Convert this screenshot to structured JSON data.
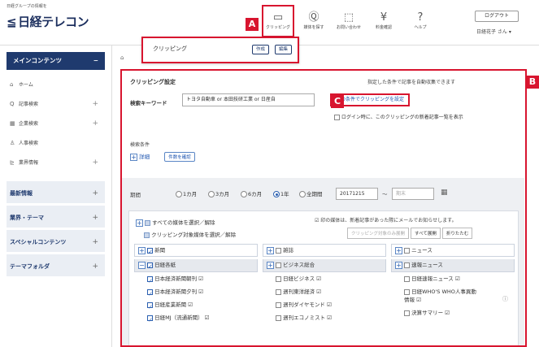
{
  "header": {
    "tagline": "日経グループの情報を",
    "logo": "日経テレコン",
    "logo_mark": "≦",
    "nav": [
      {
        "label": "クリッピング",
        "icon": "folder-icon",
        "glyph": "▭"
      },
      {
        "label": "媒体を探す",
        "icon": "search-icon",
        "glyph": "Ⓠ"
      },
      {
        "label": "お問い合わせ",
        "icon": "chat-icon",
        "glyph": "⬚"
      },
      {
        "label": "料金確認",
        "icon": "yen-icon",
        "glyph": "¥"
      },
      {
        "label": "ヘルプ",
        "icon": "help-icon",
        "glyph": "?"
      }
    ],
    "logout": "ログアウト",
    "user": "日経花子 さん ▾"
  },
  "popup": {
    "label": "クリッピング",
    "create": "作成",
    "edit": "編集"
  },
  "tab_stub": "⌂",
  "sidebar": {
    "head": "メインコンテンツ",
    "head_toggle": "−",
    "items": [
      {
        "label": "ホーム",
        "icon": "⌂",
        "plus": ""
      },
      {
        "label": "記事検索",
        "icon": "Q",
        "plus": "+"
      },
      {
        "label": "企業検索",
        "icon": "▦",
        "plus": "+"
      },
      {
        "label": "人事検索",
        "icon": "♙",
        "plus": ""
      },
      {
        "label": "業界情報",
        "icon": "⊵",
        "plus": "+"
      }
    ],
    "categories": [
      {
        "label": "最新情報",
        "plus": "+"
      },
      {
        "label": "業界・テーマ",
        "plus": "+"
      },
      {
        "label": "スペシャルコンテンツ",
        "plus": "+"
      },
      {
        "label": "テーマフォルダ",
        "plus": "+"
      }
    ]
  },
  "main": {
    "title": "クリッピング設定",
    "note": "指定した条件で記事を自動収集できます",
    "keyword_label": "検索キーワード",
    "keyword_value": "トヨタ自動車 or 本田技研工業 or 日産自",
    "save_link": "この条件でクリッピングを設定",
    "login_check": "ログイン時に、このクリッピングの新着記事一覧を表示",
    "conditions_label": "検索条件",
    "detail_label": "詳細",
    "confirm_btn": "件数を確認",
    "period_label": "期間",
    "periods": [
      "1カ月",
      "3カ月",
      "6カ月",
      "1年",
      "全期間"
    ],
    "selected_period": "1年",
    "date_from": "20171215",
    "date_sep": "〜",
    "date_to": "期末",
    "calendar_icon": "▦",
    "select_all": "すべての媒体を選択／解除",
    "select_clip": "クリッピング対象媒体を選択／解除",
    "notify": "☑ 印の媒体は、新着記事があった際にメールでお知らせします。",
    "tool_buttons": [
      "クリッピング対象のみ展開",
      "すべて展開",
      "折りたたむ"
    ],
    "columns": [
      {
        "head": "新聞",
        "head_checked": true,
        "sub": "日経各紙",
        "sub_checked": true,
        "items": [
          {
            "label": "日本経済新聞朝刊 ☑",
            "checked": true
          },
          {
            "label": "日本経済新聞夕刊 ☑",
            "checked": true
          },
          {
            "label": "日経産業新聞 ☑",
            "checked": true
          },
          {
            "label": "日経MJ（流通新聞） ☑",
            "checked": true
          }
        ]
      },
      {
        "head": "雑誌",
        "head_checked": false,
        "sub": "ビジネス総合",
        "sub_checked": false,
        "items": [
          {
            "label": "日経ビジネス ☑",
            "checked": false
          },
          {
            "label": "週刊東洋経済 ☑",
            "checked": false
          },
          {
            "label": "週刊ダイヤモンド ☑",
            "checked": false
          },
          {
            "label": "週刊エコノミスト ☑",
            "checked": false
          }
        ]
      },
      {
        "head": "ニュース",
        "head_checked": false,
        "sub": "速報ニュース",
        "sub_checked": false,
        "items": [
          {
            "label": "日経速報ニュース ☑",
            "checked": false
          },
          {
            "label": "日経WHO'S WHO人事異動",
            "label2": "情報 ☑",
            "checked": false
          },
          {
            "label": "決算サマリー ☑",
            "checked": false
          }
        ]
      }
    ]
  },
  "markers": {
    "a": "A",
    "b": "B",
    "c": "C"
  },
  "colors": {
    "accent": "#d8152f",
    "navy": "#1f3a6e",
    "link": "#1f56b0"
  }
}
